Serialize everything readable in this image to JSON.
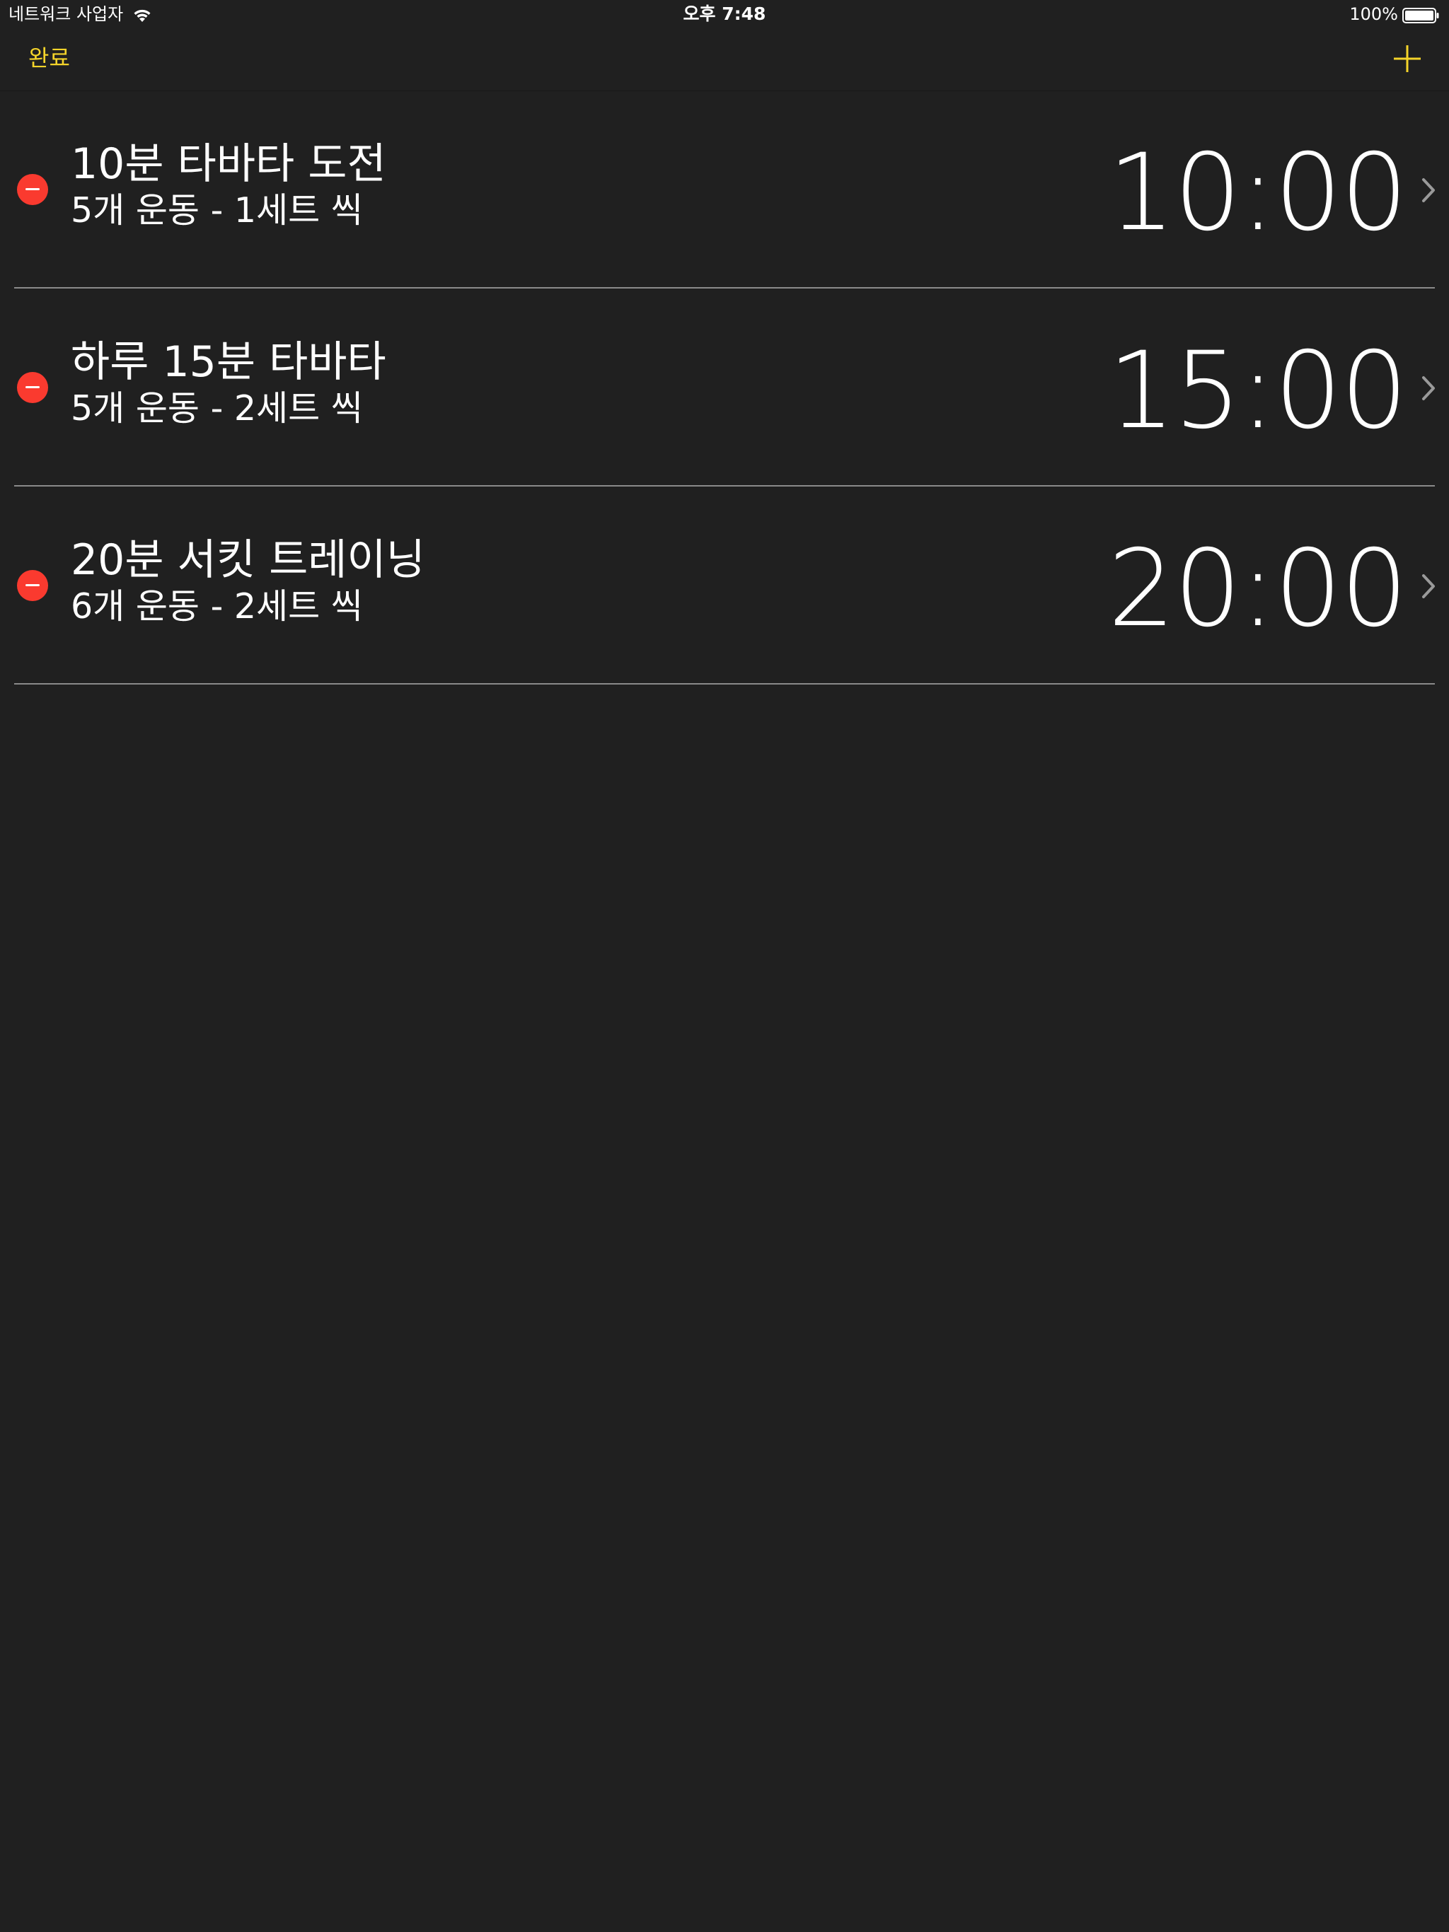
{
  "status_bar": {
    "carrier": "네트워크 사업자",
    "time": "오후 7:48",
    "battery": "100%",
    "wifi_icon": "wifi-icon",
    "battery_icon": "battery-icon"
  },
  "nav": {
    "done_label": "완료",
    "add_icon": "plus-icon",
    "accent_color": "#f5d42a"
  },
  "workouts": [
    {
      "title": "10분 타바타 도전",
      "subtitle": "5개 운동 - 1세트 씩",
      "duration": "10:00"
    },
    {
      "title": "하루 15분 타바타",
      "subtitle": "5개 운동 - 2세트 씩",
      "duration": "15:00"
    },
    {
      "title": "20분 서킷 트레이닝",
      "subtitle": "6개 운동 - 2세트 씩",
      "duration": "20:00"
    }
  ],
  "colors": {
    "background": "#202020",
    "delete": "#fa3a2f",
    "divider": "#8a8a8a"
  }
}
